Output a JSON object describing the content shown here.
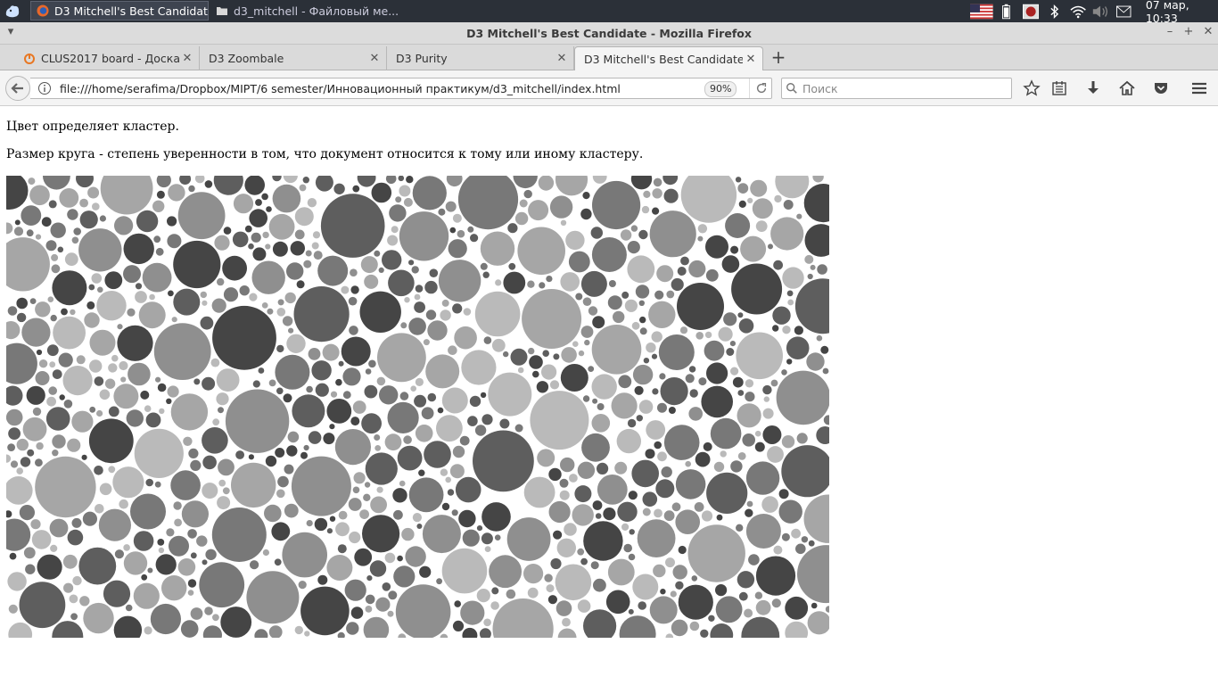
{
  "taskbar": {
    "tasks": [
      {
        "label": "D3 Mitchell's Best Candidate...",
        "active": true
      },
      {
        "label": "d3_mitchell - Файловый ме...",
        "active": false
      }
    ],
    "clock": "07 мар, 10:33"
  },
  "window": {
    "title": "D3 Mitchell's Best Candidate - Mozilla Firefox"
  },
  "tabs": [
    {
      "label": "CLUS2017 board - Доска ..."
    },
    {
      "label": "D3 Zoombale"
    },
    {
      "label": "D3 Purity"
    },
    {
      "label": "D3 Mitchell's Best Candidate"
    }
  ],
  "navbar": {
    "url": "file:///home/serafima/Dropbox/MIPT/6 semester/Инновационный практикум/d3_mitchell/index.html",
    "zoom": "90%",
    "search_placeholder": "Поиск"
  },
  "content": {
    "line1": "Цвет определяет кластер.",
    "line2": "Размер круга - степень уверенности в том, что документ относится к тому или иному кластеру."
  },
  "chart_data": {
    "type": "scatter",
    "description_of_encoding": "",
    "palette": [
      "#454545",
      "#5e5e5e",
      "#787878",
      "#8f8f8f",
      "#a6a6a6",
      "#bababa"
    ],
    "seed": 7,
    "max_radius": 36,
    "min_radius": 3,
    "attempts": 14000
  }
}
